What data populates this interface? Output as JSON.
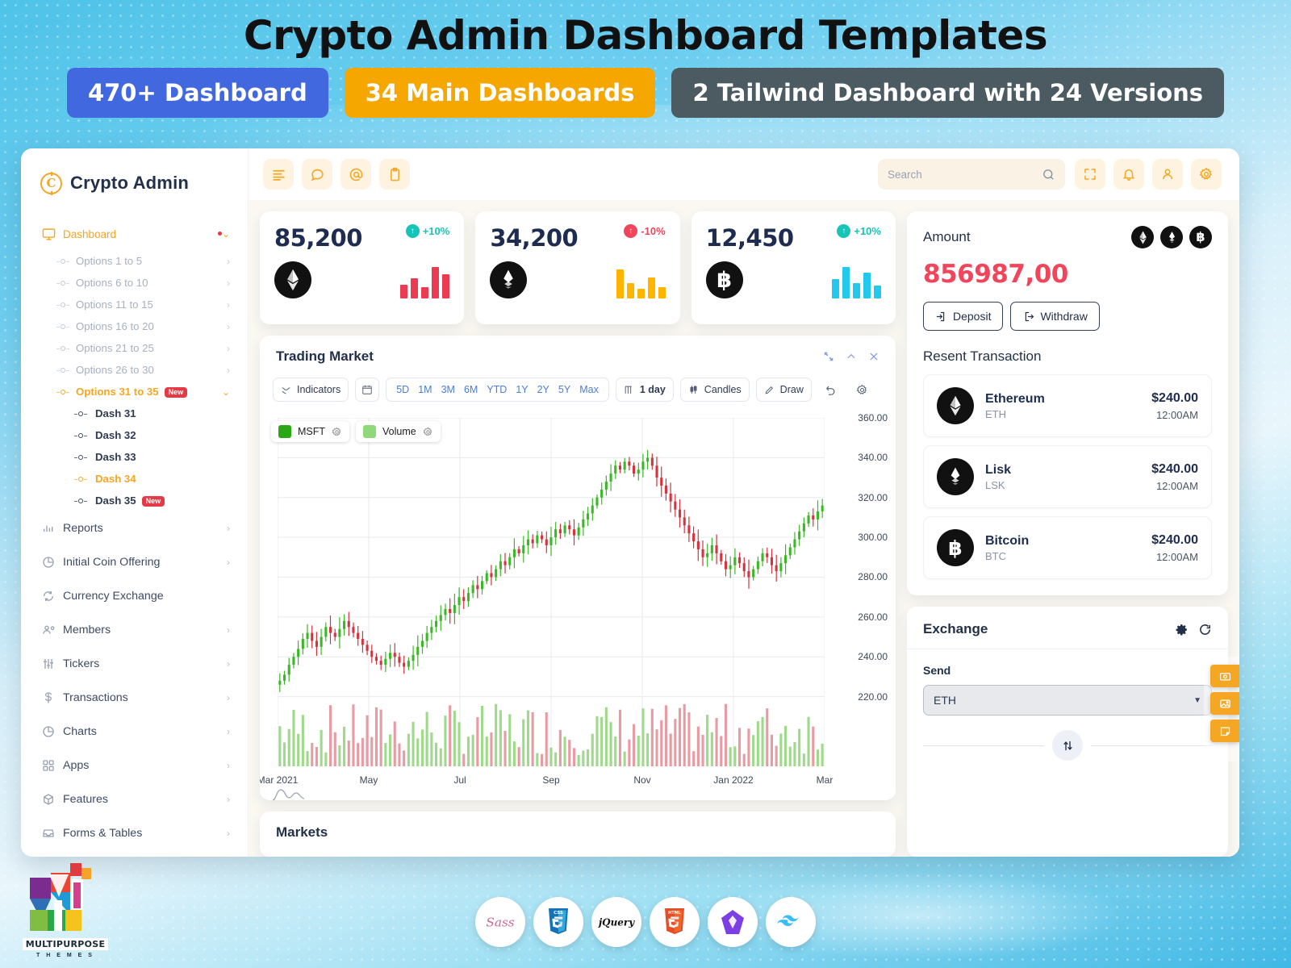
{
  "promo": {
    "title": "Crypto Admin Dashboard Templates",
    "badges": [
      {
        "label": "470+ Dashboard",
        "color": "#4268e0"
      },
      {
        "label": "34 Main Dashboards",
        "color": "#f5a700"
      },
      {
        "label": "2 Tailwind Dashboard with 24 Versions",
        "color": "#4c5a61"
      }
    ]
  },
  "brand": {
    "name": "Crypto Admin",
    "mark": "C"
  },
  "sidebar": {
    "dashboard": {
      "label": "Dashboard",
      "icon": "monitor-icon",
      "has_dot": true
    },
    "options": [
      {
        "label": "Options 1 to 5"
      },
      {
        "label": "Options 6 to 10"
      },
      {
        "label": "Options 11 to 15"
      },
      {
        "label": "Options 16 to 20"
      },
      {
        "label": "Options 21 to 25"
      },
      {
        "label": "Options 26 to 30"
      },
      {
        "label": "Options 31 to 35",
        "badge": "New",
        "expanded": true
      }
    ],
    "dashes": [
      {
        "label": "Dash 31"
      },
      {
        "label": "Dash 32"
      },
      {
        "label": "Dash 33"
      },
      {
        "label": "Dash 34",
        "current": true
      },
      {
        "label": "Dash 35",
        "badge": "New"
      }
    ],
    "items": [
      {
        "label": "Reports",
        "icon": "bar-chart-icon"
      },
      {
        "label": "Initial Coin Offering",
        "icon": "pie-chart-icon"
      },
      {
        "label": "Currency Exchange",
        "icon": "refresh-icon"
      },
      {
        "label": "Members",
        "icon": "users-icon"
      },
      {
        "label": "Tickers",
        "icon": "sliders-icon"
      },
      {
        "label": "Transactions",
        "icon": "dollar-icon"
      },
      {
        "label": "Charts",
        "icon": "pie-chart-icon"
      },
      {
        "label": "Apps",
        "icon": "grid-icon"
      },
      {
        "label": "Features",
        "icon": "box-icon"
      },
      {
        "label": "Forms & Tables",
        "icon": "inbox-icon"
      }
    ]
  },
  "topbar": {
    "left_icons": [
      "menu-icon",
      "chat-icon",
      "at-icon",
      "clipboard-icon"
    ],
    "right_icons": [
      "fullscreen-icon",
      "bell-icon",
      "user-icon",
      "gear-icon"
    ],
    "search_placeholder": "Search",
    "search_value": ""
  },
  "stats": [
    {
      "value": "85,200",
      "change": "+10%",
      "direction": "up",
      "coin": "ethereum-icon",
      "bar_color": "#ea3b52",
      "bars": [
        38,
        52,
        30,
        86,
        66
      ]
    },
    {
      "value": "34,200",
      "change": "-10%",
      "direction": "down",
      "coin": "lisk-icon",
      "bar_color": "#ffb400",
      "bars": [
        80,
        42,
        28,
        56,
        30
      ]
    },
    {
      "value": "12,450",
      "change": "+10%",
      "direction": "up",
      "coin": "bitcoin-icon",
      "bar_color": "#22c8ee",
      "bars": [
        54,
        86,
        42,
        70,
        34
      ]
    }
  ],
  "trading": {
    "title": "Trading Market",
    "window_actions": [
      "expand-icon",
      "collapse-icon",
      "close-icon"
    ],
    "toolbar": {
      "indicators_label": "Indicators",
      "calendar_icon": "calendar-icon",
      "ranges": [
        "5D",
        "1M",
        "3M",
        "6M",
        "YTD",
        "1Y",
        "2Y",
        "5Y",
        "Max"
      ],
      "interval_label": "1 day",
      "chart_type_label": "Candles",
      "draw_label": "Draw",
      "undo_icon": "undo-icon",
      "settings_icon": "gear-icon"
    }
  },
  "chart_data": {
    "type": "line",
    "subtype": "candlestick-with-volume",
    "title": "Trading Market",
    "legend": [
      {
        "name": "MSFT",
        "color": "#2aa814"
      },
      {
        "name": "Volume",
        "color": "#8fd97a"
      }
    ],
    "legend_position": "top-left",
    "grid": true,
    "xlabel": "",
    "ylabel": "",
    "ylim": [
      220.0,
      360.0
    ],
    "yticks": [
      "220.00",
      "240.00",
      "260.00",
      "280.00",
      "300.00",
      "320.00",
      "340.00",
      "360.00"
    ],
    "xticks": [
      "Mar 2021",
      "May",
      "Jul",
      "Sep",
      "Nov",
      "Jan 2022",
      "Mar"
    ],
    "up_color": "#3bb825",
    "down_color": "#d6333e",
    "series": [
      {
        "name": "MSFT",
        "closes": [
          228,
          231,
          236,
          240,
          244,
          249,
          252,
          248,
          245,
          250,
          255,
          252,
          250,
          254,
          258,
          255,
          252,
          249,
          246,
          243,
          240,
          238,
          236,
          239,
          242,
          240,
          237,
          235,
          238,
          241,
          245,
          248,
          252,
          255,
          258,
          261,
          264,
          262,
          266,
          270,
          268,
          272,
          276,
          274,
          278,
          282,
          280,
          284,
          288,
          286,
          290,
          294,
          292,
          296,
          299,
          297,
          301,
          299,
          296,
          300,
          304,
          302,
          306,
          304,
          301,
          305,
          309,
          312,
          316,
          320,
          324,
          328,
          332,
          336,
          334,
          338,
          336,
          332,
          334,
          338,
          340,
          336,
          330,
          326,
          322,
          318,
          314,
          310,
          306,
          302,
          298,
          294,
          290,
          292,
          296,
          292,
          288,
          284,
          286,
          290,
          287,
          283,
          280,
          284,
          288,
          292,
          290,
          286,
          283,
          287,
          291,
          295,
          299,
          303,
          307,
          311,
          309,
          313,
          316
        ]
      },
      {
        "name": "Volume",
        "note": "daily volume bars below price panel, green when up, red when down"
      }
    ]
  },
  "markets": {
    "title": "Markets"
  },
  "amount": {
    "title": "Amount",
    "value": "856987,00",
    "coins": [
      "ethereum-icon",
      "lisk-icon",
      "bitcoin-icon"
    ],
    "deposit_label": "Deposit",
    "withdraw_label": "Withdraw",
    "transactions_title": "Resent Transaction",
    "transactions": [
      {
        "name": "Ethereum",
        "symbol": "ETH",
        "amount": "$240.00",
        "time": "12:00AM",
        "icon": "ethereum-icon"
      },
      {
        "name": "Lisk",
        "symbol": "LSK",
        "amount": "$240.00",
        "time": "12:00AM",
        "icon": "lisk-icon"
      },
      {
        "name": "Bitcoin",
        "symbol": "BTC",
        "amount": "$240.00",
        "time": "12:00AM",
        "icon": "bitcoin-icon"
      }
    ]
  },
  "exchange": {
    "title": "Exchange",
    "actions": [
      "gear-icon",
      "refresh-icon"
    ],
    "send_label": "Send",
    "send_value": "ETH",
    "swap_icon": "swap-vertical-icon"
  },
  "edge_tabs": [
    "camera-icon",
    "image-icon",
    "note-icon"
  ],
  "footer": {
    "logo_caption": "MULTIPURPOSE",
    "logo_sub": "T H E M E S",
    "tech": [
      "sass-icon",
      "css3-icon",
      "jquery-icon",
      "html5-icon",
      "gulp-icon",
      "tailwind-icon"
    ]
  }
}
